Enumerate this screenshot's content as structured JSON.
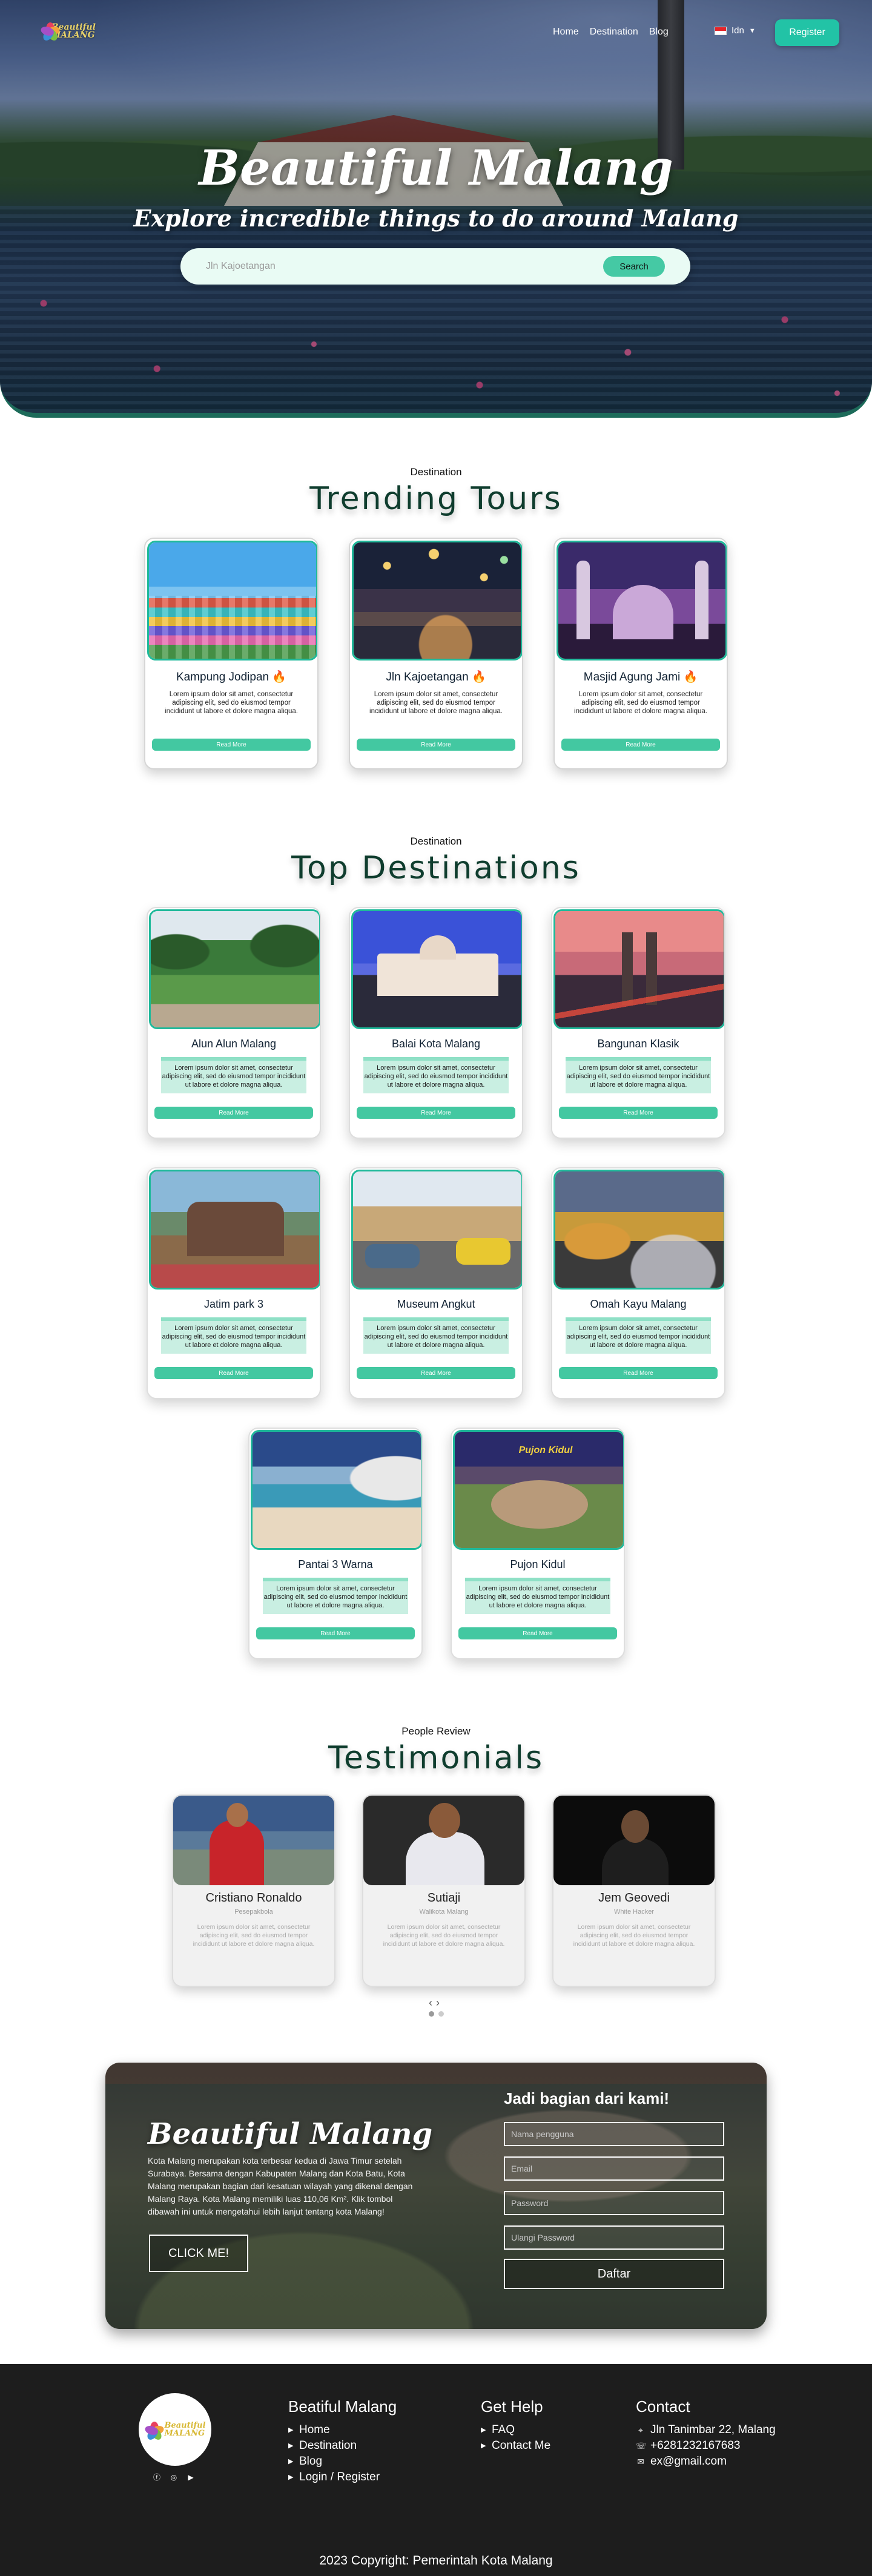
{
  "brand": {
    "logo_line1": "Beautiful",
    "logo_line2": "MALANG"
  },
  "nav": {
    "links": [
      "Home",
      "Destination",
      "Blog"
    ],
    "language": "Idn",
    "register_label": "Register"
  },
  "hero": {
    "title": "Beautiful Malang",
    "subtitle": "Explore incredible things to do around Malang",
    "search_placeholder": "Jln Kajoetangan",
    "search_label": "Search"
  },
  "trending": {
    "eyebrow": "Destination",
    "title": "Trending Tours",
    "read_more": "Read More",
    "cards": [
      {
        "name": "Kampung Jodipan",
        "icon": "fire-icon",
        "desc": "Lorem ipsum dolor sit amet, consectetur adipiscing elit, sed do eiusmod tempor incididunt ut labore et dolore magna aliqua."
      },
      {
        "name": "Jln Kajoetangan",
        "icon": "fire-icon",
        "desc": "Lorem ipsum dolor sit amet, consectetur adipiscing elit, sed do eiusmod tempor incididunt ut labore et dolore magna aliqua."
      },
      {
        "name": "Masjid Agung Jami",
        "icon": "fire-icon",
        "desc": "Lorem ipsum dolor sit amet, consectetur adipiscing elit, sed do eiusmod tempor incididunt ut labore et dolore magna aliqua."
      }
    ]
  },
  "destinations": {
    "eyebrow": "Destination",
    "title": "Top Destinations",
    "read_more": "Read More",
    "cards": [
      {
        "name": "Alun Alun Malang",
        "desc": "Lorem ipsum dolor sit amet, consectetur adipiscing elit, sed do eiusmod tempor incididunt ut labore et dolore magna aliqua."
      },
      {
        "name": "Balai Kota Malang",
        "desc": "Lorem ipsum dolor sit amet, consectetur adipiscing elit, sed do eiusmod tempor incididunt ut labore et dolore magna aliqua."
      },
      {
        "name": "Bangunan Klasik",
        "desc": "Lorem ipsum dolor sit amet, consectetur adipiscing elit, sed do eiusmod tempor incididunt ut labore et dolore magna aliqua."
      },
      {
        "name": "Jatim park 3",
        "desc": "Lorem ipsum dolor sit amet, consectetur adipiscing elit, sed do eiusmod tempor incididunt ut labore et dolore magna aliqua."
      },
      {
        "name": "Museum Angkut",
        "desc": "Lorem ipsum dolor sit amet, consectetur adipiscing elit, sed do eiusmod tempor incididunt ut labore et dolore magna aliqua."
      },
      {
        "name": "Omah Kayu Malang",
        "desc": "Lorem ipsum dolor sit amet, consectetur adipiscing elit, sed do eiusmod tempor incididunt ut labore et dolore magna aliqua."
      },
      {
        "name": "Pantai 3 Warna",
        "desc": "Lorem ipsum dolor sit amet, consectetur adipiscing elit, sed do eiusmod tempor incididunt ut labore et dolore magna aliqua."
      },
      {
        "name": "Pujon Kidul",
        "desc": "Lorem ipsum dolor sit amet, consectetur adipiscing elit, sed do eiusmod tempor incididunt ut labore et dolore magna aliqua."
      }
    ],
    "pujon_sign": "Pujon Kidul"
  },
  "testimonials": {
    "eyebrow": "People Review",
    "title": "Testimonials",
    "cards": [
      {
        "name": "Cristiano Ronaldo",
        "role": "Pesepakbola",
        "quote": "Lorem ipsum dolor sit amet, consectetur adipiscing elit, sed do eiusmod tempor incididunt ut labore et dolore magna aliqua."
      },
      {
        "name": "Sutiaji",
        "role": "Walikota Malang",
        "quote": "Lorem ipsum dolor sit amet, consectetur adipiscing elit, sed do eiusmod tempor incididunt ut labore et dolore magna aliqua."
      },
      {
        "name": "Jem Geovedi",
        "role": "White Hacker",
        "quote": "Lorem ipsum dolor sit amet, consectetur adipiscing elit, sed do eiusmod tempor incididunt ut labore et dolore magna aliqua."
      }
    ],
    "prev": "‹",
    "next": "›"
  },
  "join": {
    "title": "Beautiful Malang",
    "desc": "Kota Malang merupakan kota terbesar kedua di Jawa Timur setelah Surabaya. Bersama dengan Kabupaten Malang dan Kota Batu, Kota Malang merupakan bagian dari kesatuan wilayah yang dikenal dengan Malang Raya. Kota Malang memiliki luas 110,06 Km². Klik tombol dibawah ini untuk mengetahui lebih lanjut tentang kota Malang!",
    "cta_label": "CLICK ME!",
    "form_title": "Jadi bagian dari kami!",
    "placeholders": {
      "username": "Nama pengguna",
      "email": "Email",
      "password": "Password",
      "confirm": "Ulangi Password"
    },
    "submit_label": "Daftar"
  },
  "footer": {
    "col1": {
      "title": "Beatiful Malang",
      "links": [
        "Home",
        "Destination",
        "Blog",
        "Login / Register"
      ]
    },
    "col2": {
      "title": "Get Help",
      "links": [
        "FAQ",
        "Contact Me"
      ]
    },
    "col3": {
      "title": "Contact",
      "address": "Jln Tanimbar 22, Malang",
      "phone": "+6281232167683",
      "email": "ex@gmail.com"
    },
    "copyright": "2023 Copyright: Pemerintah Kota Malang"
  },
  "colors": {
    "accent": "#22c3a6",
    "button": "#43c8a1",
    "heading": "#0f3d2e",
    "footer": "#1d1d1d"
  }
}
